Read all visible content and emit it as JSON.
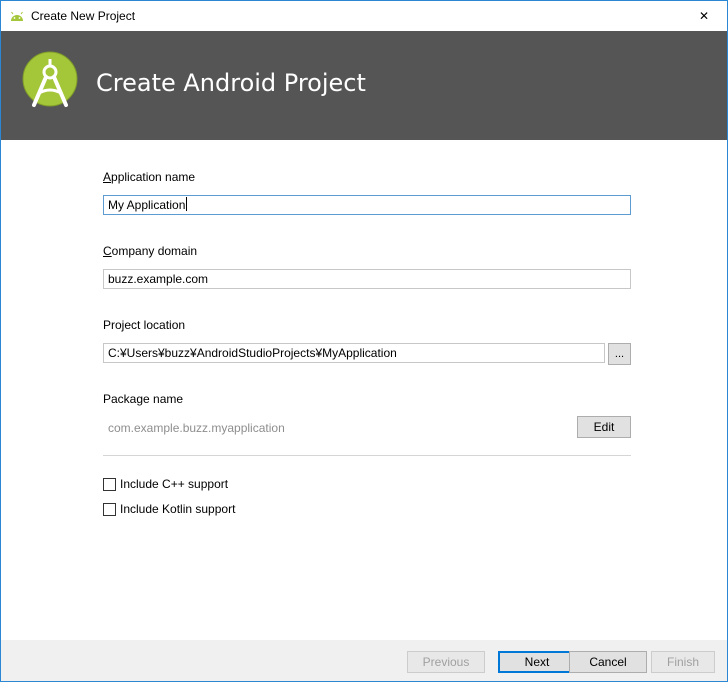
{
  "window": {
    "title": "Create New Project",
    "close_glyph": "✕"
  },
  "banner": {
    "heading": "Create Android Project"
  },
  "form": {
    "app_name": {
      "label_mnemonic": "A",
      "label_rest": "pplication name",
      "value": "My Application"
    },
    "company_domain": {
      "label_mnemonic": "C",
      "label_rest": "ompany domain",
      "value": "buzz.example.com"
    },
    "project_location": {
      "label": "Project location",
      "value": "C:¥Users¥buzz¥AndroidStudioProjects¥MyApplication",
      "browse_label": "..."
    },
    "package_name": {
      "label": "Package name",
      "value": "com.example.buzz.myapplication",
      "edit_label": "Edit"
    },
    "options": {
      "cpp": {
        "label": "Include C++ support",
        "checked": false
      },
      "kotlin": {
        "label": "Include Kotlin support",
        "checked": false
      }
    }
  },
  "footer": {
    "previous": "Previous",
    "next": "Next",
    "cancel": "Cancel",
    "finish": "Finish"
  },
  "colors": {
    "banner_bg": "#555555",
    "android_green": "#a4c639",
    "focus_border": "#5e9bd1",
    "primary_border": "#0078d7"
  },
  "icons": {
    "app": "android-icon",
    "logo": "android-studio-logo-icon",
    "close": "close-icon"
  }
}
